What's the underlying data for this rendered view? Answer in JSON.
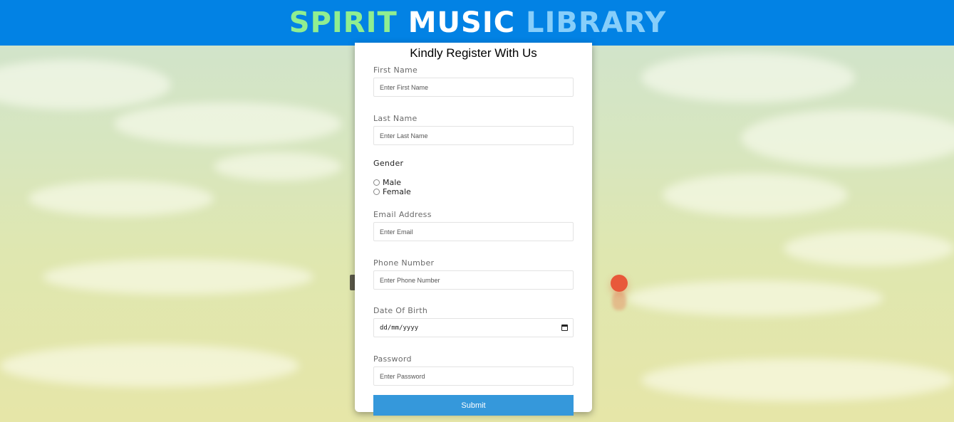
{
  "header": {
    "title_words": [
      "SPIRIT",
      "MUSIC",
      "LIBRARY"
    ],
    "colors": {
      "bar": "#0282e4",
      "word1": "#90ee90",
      "word2": "#ffffff",
      "word3": "#87cefa"
    }
  },
  "form": {
    "heading": "Kindly Register With Us",
    "first_name": {
      "label": "First Name",
      "placeholder": "Enter First Name"
    },
    "last_name": {
      "label": "Last Name",
      "placeholder": "Enter Last Name"
    },
    "gender": {
      "label": "Gender",
      "options": [
        "Male",
        "Female"
      ]
    },
    "email": {
      "label": "Email Address",
      "placeholder": "Enter Email"
    },
    "phone": {
      "label": "Phone Number",
      "placeholder": "Enter Phone Number"
    },
    "dob": {
      "label": "Date Of Birth",
      "placeholder": "dd/mm/yyyy",
      "icon": "calendar-icon"
    },
    "password": {
      "label": "Password",
      "placeholder": "Enter Password"
    },
    "submit_label": "Submit",
    "submit_color": "#3598db"
  }
}
